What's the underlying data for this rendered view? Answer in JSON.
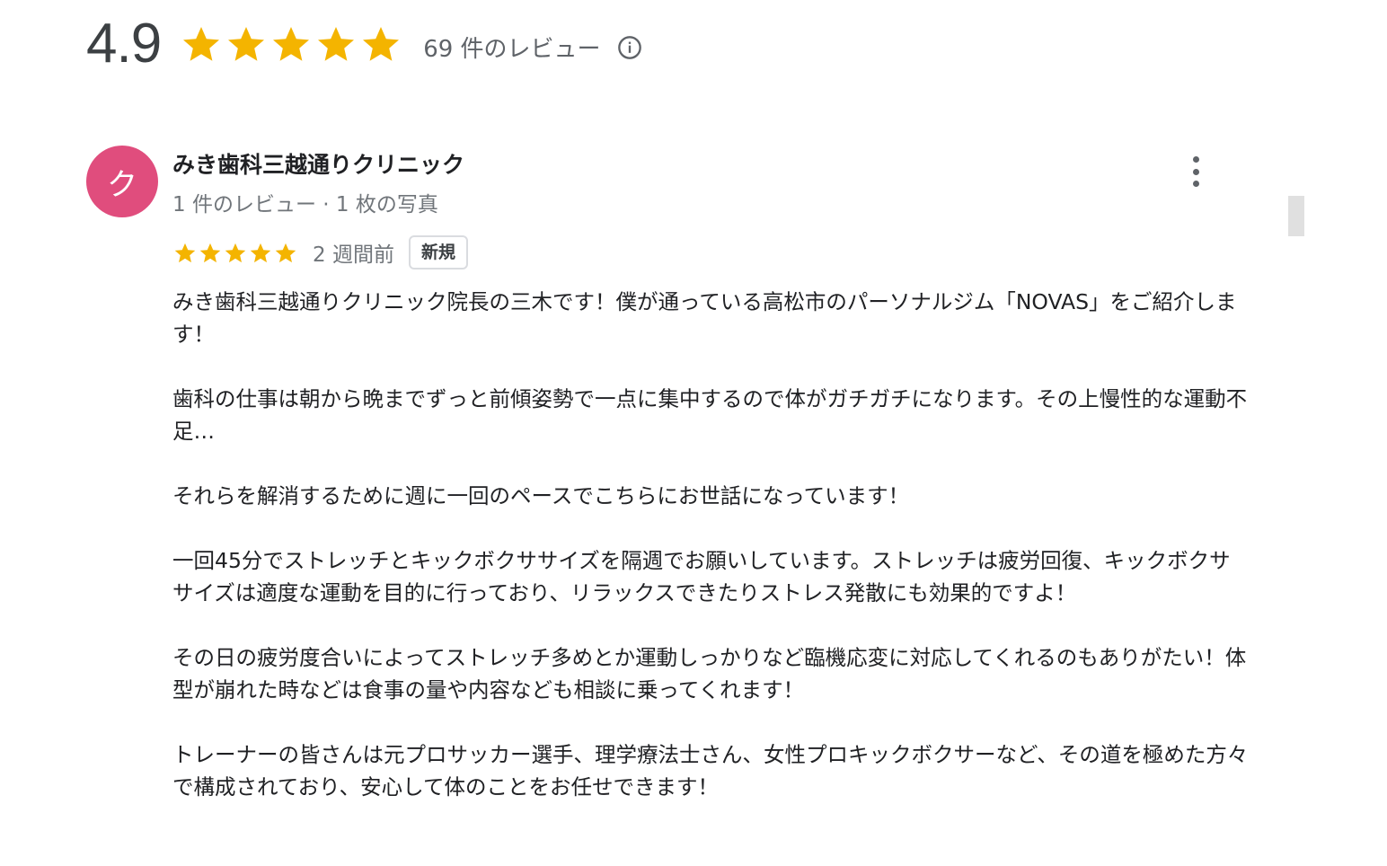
{
  "summary": {
    "rating": "4.9",
    "stars_filled": 5,
    "stars_total": 5,
    "review_count_label": "69 件のレビュー",
    "info_icon": "info-icon"
  },
  "colors": {
    "star": "#f4b400",
    "avatar_bg": "#e04d7d",
    "muted_text": "#70757a"
  },
  "review": {
    "avatar_initial": "ク",
    "reviewer_name": "みき歯科三越通りクリニック",
    "reviewer_meta": "1 件のレビュー · 1 枚の写真",
    "rating": 5,
    "time": "2 週間前",
    "badge": "新規",
    "more_icon": "more-vert-icon",
    "paragraphs": [
      "みき歯科三越通りクリニック院長の三木です！僕が通っている高松市のパーソナルジム「NOVAS」をご紹介します！",
      "歯科の仕事は朝から晩までずっと前傾姿勢で一点に集中するので体がガチガチになります。その上慢性的な運動不足…",
      "それらを解消するために週に一回のペースでこちらにお世話になっています！",
      "一回45分でストレッチとキックボクササイズを隔週でお願いしています。ストレッチは疲労回復、キックボクササイズは適度な運動を目的に行っており、リラックスできたりストレス発散にも効果的ですよ！",
      "その日の疲労度合いによってストレッチ多めとか運動しっかりなど臨機応変に対応してくれるのもありがたい！体型が崩れた時などは食事の量や内容なども相談に乗ってくれます！",
      "トレーナーの皆さんは元プロサッカー選手、理学療法士さん、女性プロキックボクサーなど、その道を極めた方々で構成されており、安心して体のことをお任せできます！"
    ]
  }
}
